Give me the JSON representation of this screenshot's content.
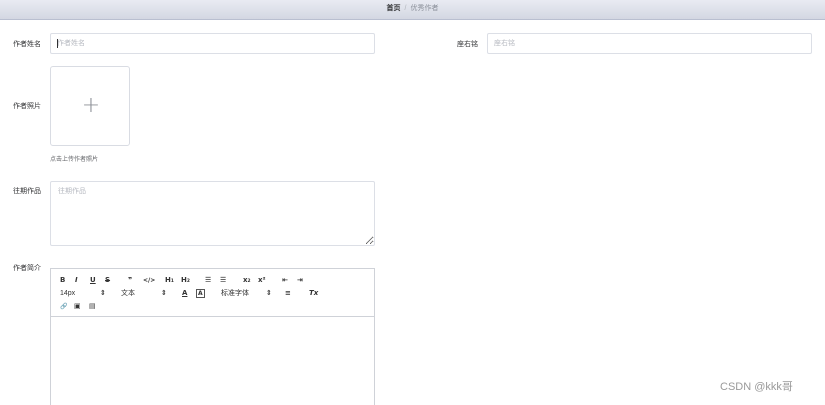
{
  "breadcrumb": {
    "home": "首页",
    "separator": "/",
    "current": "优秀作者"
  },
  "form": {
    "author_name": {
      "label": "作者姓名",
      "placeholder": "作者姓名",
      "value": ""
    },
    "motto": {
      "label": "座右铭",
      "placeholder": "座右铭",
      "value": ""
    },
    "photo": {
      "label": "作者照片",
      "tip": "点击上传作者照片",
      "plus": "+"
    },
    "past_works": {
      "label": "往期作品",
      "placeholder": "往期作品"
    },
    "intro": {
      "label": "作者简介"
    }
  },
  "editor_toolbar": {
    "bold": "B",
    "italic": "I",
    "underline": "U",
    "strike": "S",
    "quote": "❞",
    "code": "</>",
    "h1": "H₁",
    "h2": "H₂",
    "ordered_list": "☰",
    "bullet_list": "☰",
    "subscript": "x₂",
    "superscript": "x²",
    "indent_decrease": "⇤",
    "indent_increase": "⇥",
    "font_size": "14px",
    "text_style": "文本",
    "font_color": "A",
    "bg_color": "A",
    "font_family": "标准字体",
    "align": "≡",
    "clean": "Tx",
    "link": "🔗",
    "image": "▣",
    "video": "▤",
    "select_arrow": "⇕"
  },
  "watermark": "CSDN @kkk哥"
}
